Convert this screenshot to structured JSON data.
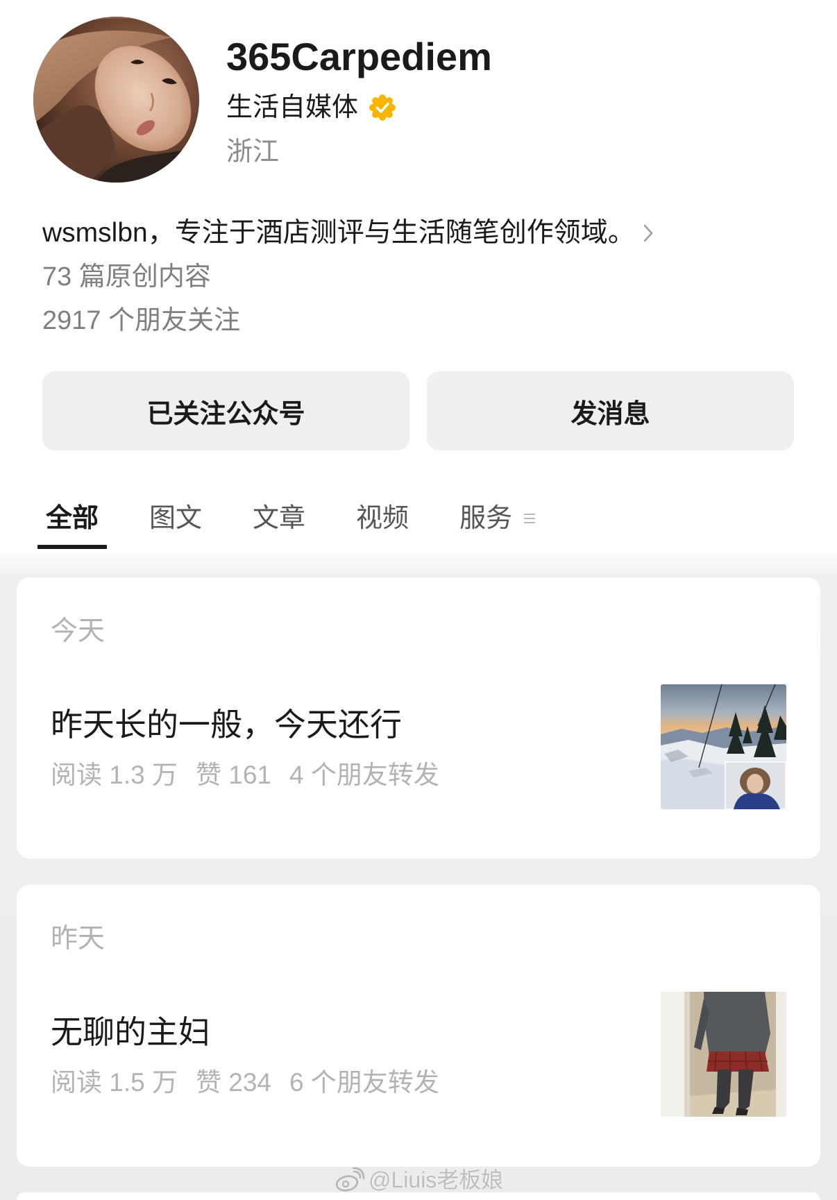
{
  "profile": {
    "name": "365Carpediem",
    "category": "生活自媒体",
    "location": "浙江",
    "bio": "wsmslbn，专注于酒店测评与生活随笔创作领域。",
    "original_count": "73 篇原创内容",
    "friends_following": "2917 个朋友关注",
    "verified": true
  },
  "actions": {
    "follow_label": "已关注公众号",
    "message_label": "发消息"
  },
  "tabs": [
    {
      "label": "全部",
      "active": true
    },
    {
      "label": "图文",
      "active": false
    },
    {
      "label": "文章",
      "active": false
    },
    {
      "label": "视频",
      "active": false
    },
    {
      "label": "服务",
      "active": false
    }
  ],
  "feed": [
    {
      "date": "今天",
      "title": "昨天长的一般，今天还行",
      "reads": "阅读 1.3 万",
      "likes": "赞 161",
      "shares": "4 个朋友转发"
    },
    {
      "date": "昨天",
      "title": "无聊的主妇",
      "reads": "阅读 1.5 万",
      "likes": "赞 234",
      "shares": "6 个朋友转发"
    }
  ],
  "watermark": {
    "text": "@Liuis老板娘"
  },
  "icons": {
    "verified": "verified-badge-icon",
    "bio_more": "chevron-right-icon",
    "tabs_more": "menu-icon",
    "watermark_logo": "weibo-logo-icon"
  },
  "colors": {
    "text_primary": "#1a1a1a",
    "text_secondary": "#7f7f7f",
    "text_tertiary": "#b3b3b3",
    "tab_inactive": "#555555",
    "button_bg": "#efefef",
    "verified": "#f7b500",
    "feed_bg": "#ececec",
    "card_bg": "#ffffff"
  }
}
